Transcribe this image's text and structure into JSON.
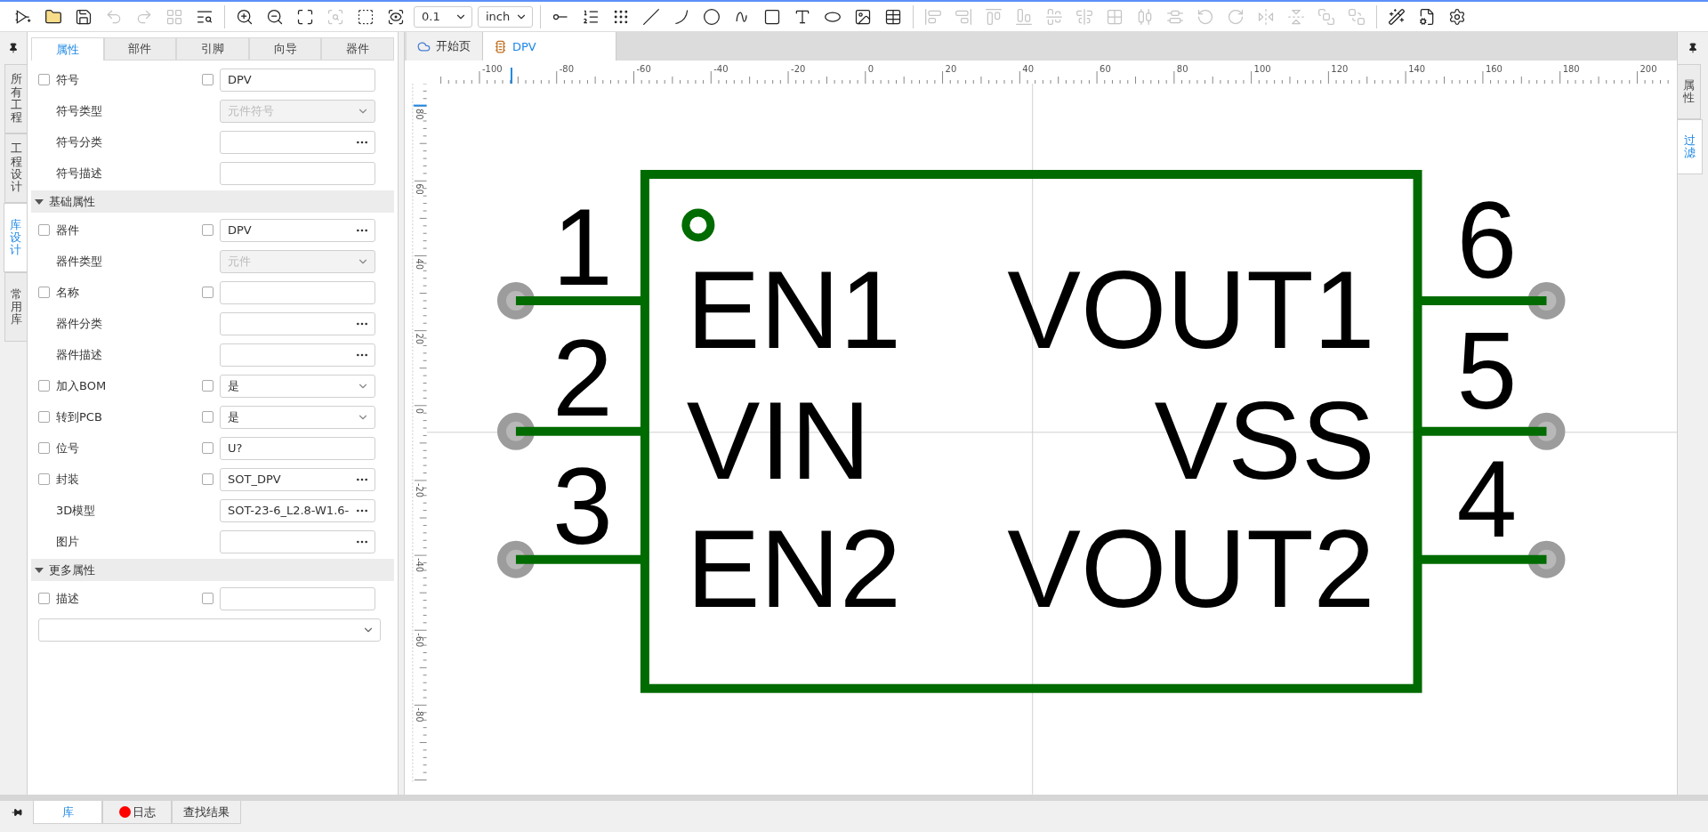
{
  "toolbar": {
    "groups": [
      {
        "items": [
          {
            "kind": "chip",
            "disabled": false
          },
          {
            "kind": "folder",
            "disabled": false
          },
          {
            "kind": "save",
            "disabled": false
          },
          {
            "kind": "undo",
            "disabled": true
          },
          {
            "kind": "redo",
            "disabled": true
          },
          {
            "kind": "grid",
            "disabled": true
          },
          {
            "kind": "list-search",
            "disabled": false
          }
        ]
      },
      {
        "items": [
          {
            "kind": "zoom-in",
            "disabled": false
          },
          {
            "kind": "zoom-out",
            "disabled": false
          },
          {
            "kind": "expand",
            "disabled": false
          },
          {
            "kind": "zoom-area",
            "disabled": true
          },
          {
            "kind": "zoom-select",
            "disabled": false
          },
          {
            "kind": "scan-eye",
            "disabled": false
          },
          {
            "kind": "select",
            "value": "0.1"
          },
          {
            "kind": "select",
            "value": "inch"
          }
        ]
      },
      {
        "items": [
          {
            "kind": "pin",
            "disabled": false
          },
          {
            "kind": "pin-list",
            "disabled": false
          },
          {
            "kind": "pin-array",
            "disabled": false
          },
          {
            "kind": "line",
            "disabled": false
          },
          {
            "kind": "arc",
            "disabled": false
          },
          {
            "kind": "circle",
            "disabled": false
          },
          {
            "kind": "curve",
            "disabled": false
          },
          {
            "kind": "rect",
            "disabled": false
          },
          {
            "kind": "text",
            "disabled": false
          },
          {
            "kind": "ellipse",
            "disabled": false
          },
          {
            "kind": "image",
            "disabled": false
          },
          {
            "kind": "table",
            "disabled": false
          }
        ]
      },
      {
        "items": [
          {
            "kind": "align-left",
            "disabled": true
          },
          {
            "kind": "align-right",
            "disabled": true
          },
          {
            "kind": "align-top",
            "disabled": true
          },
          {
            "kind": "align-bottom",
            "disabled": true
          },
          {
            "kind": "align-center-h",
            "disabled": true
          },
          {
            "kind": "align-center-v",
            "disabled": true
          },
          {
            "kind": "grid-distribute",
            "disabled": true
          },
          {
            "kind": "distribute-h",
            "disabled": true
          },
          {
            "kind": "distribute-v",
            "disabled": true
          },
          {
            "kind": "rotate-left",
            "disabled": true
          },
          {
            "kind": "rotate-right",
            "disabled": true
          },
          {
            "kind": "flip-h",
            "disabled": true
          },
          {
            "kind": "flip-v",
            "disabled": true
          },
          {
            "kind": "bring-front",
            "disabled": true
          },
          {
            "kind": "send-back",
            "disabled": true
          }
        ]
      },
      {
        "items": [
          {
            "kind": "wand",
            "disabled": false
          },
          {
            "kind": "file-cog",
            "disabled": false
          },
          {
            "kind": "settings",
            "disabled": false
          }
        ]
      }
    ]
  },
  "left_tabs": [
    {
      "label": "所有工程",
      "selected": false
    },
    {
      "label": "工程设计",
      "selected": false
    },
    {
      "label": "库设计",
      "selected": true
    },
    {
      "label": "常用库",
      "selected": false
    }
  ],
  "panel_tabs": [
    {
      "label": "属性",
      "selected": true
    },
    {
      "label": "部件",
      "selected": false
    },
    {
      "label": "引脚",
      "selected": false
    },
    {
      "label": "向导",
      "selected": false
    },
    {
      "label": "器件",
      "selected": false
    }
  ],
  "groups": [
    {
      "rows": [
        {
          "label": "符号",
          "checked": false,
          "value_checked": false,
          "kind": "text",
          "value": "DPV"
        },
        {
          "label": "符号类型",
          "kind": "select",
          "disabled": true,
          "value": "元件符号"
        },
        {
          "label": "符号分类",
          "kind": "more"
        },
        {
          "label": "符号描述",
          "kind": "text"
        }
      ]
    },
    {
      "title": "基础属性",
      "expanded": true,
      "rows": [
        {
          "label": "器件",
          "checked": false,
          "value_checked": false,
          "kind": "more",
          "value": "DPV"
        },
        {
          "label": "器件类型",
          "kind": "select",
          "disabled": true,
          "value": "元件"
        },
        {
          "label": "名称",
          "checked": false,
          "value_checked": false,
          "kind": "text"
        },
        {
          "label": "器件分类",
          "kind": "more"
        },
        {
          "label": "器件描述",
          "kind": "more"
        },
        {
          "label": "加入BOM",
          "checked": false,
          "value_checked": false,
          "kind": "select",
          "value": "是"
        },
        {
          "label": "转到PCB",
          "checked": false,
          "value_checked": false,
          "kind": "select",
          "value": "是"
        },
        {
          "label": "位号",
          "checked": false,
          "value_checked": false,
          "kind": "text",
          "value": "U?"
        },
        {
          "label": "封装",
          "checked": false,
          "value_checked": false,
          "kind": "more",
          "value": "SOT_DPV"
        },
        {
          "label": "3D模型",
          "kind": "more",
          "value": "SOT-23-6_L2.8-W1.6-"
        },
        {
          "label": "图片",
          "kind": "more"
        }
      ]
    },
    {
      "title": "更多属性",
      "expanded": true,
      "rows": [
        {
          "label": "描述",
          "checked": false,
          "value_checked": false,
          "kind": "text"
        },
        {
          "kind": "wide-select"
        }
      ]
    }
  ],
  "document_tabs": [
    {
      "kind": "home",
      "label": "开始页",
      "selected": false
    },
    {
      "kind": "symbol",
      "label": "DPV",
      "selected": true
    }
  ],
  "rulers": {
    "horizontal": [
      "-100",
      "-80",
      "-60",
      "-40",
      "-20",
      "0",
      "20",
      "40",
      "60",
      "80",
      "100",
      "120",
      "140",
      "160",
      "180",
      "200"
    ],
    "vertical": [
      "80",
      "60",
      "40",
      "20",
      "0",
      "-20",
      "-40",
      "-60",
      "-80"
    ]
  },
  "symbol": {
    "pins": [
      {
        "number": "1",
        "name": "EN1",
        "kind": "left"
      },
      {
        "number": "2",
        "name": "VIN",
        "kind": "left"
      },
      {
        "number": "3",
        "name": "EN2",
        "kind": "left"
      },
      {
        "number": "6",
        "name": "VOUT1",
        "kind": "right"
      },
      {
        "number": "5",
        "name": "VSS",
        "kind": "right"
      },
      {
        "number": "4",
        "name": "VOUT2",
        "kind": "right"
      }
    ]
  },
  "right_tabs": [
    {
      "label": "属性",
      "selected": false
    },
    {
      "label": "过滤",
      "selected": true
    }
  ],
  "bottom_tabs": [
    {
      "kind": "plain",
      "label": "库",
      "selected": true
    },
    {
      "kind": "log",
      "label": "日志",
      "selected": false
    },
    {
      "kind": "plain",
      "label": "查找结果",
      "selected": false
    }
  ]
}
